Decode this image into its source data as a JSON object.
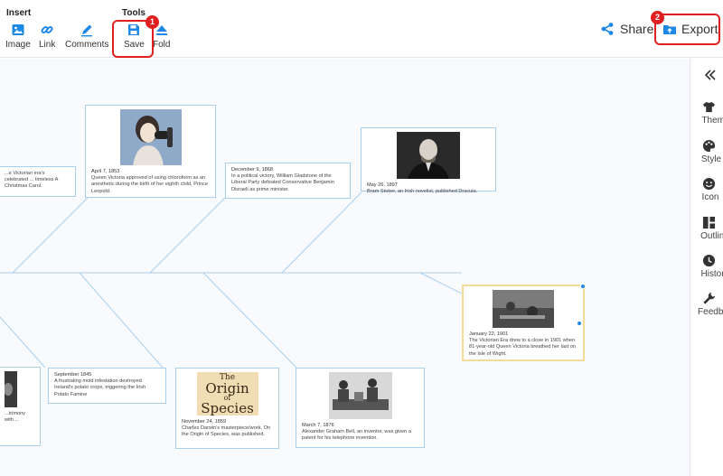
{
  "toolbar": {
    "insert_title": "Insert",
    "tools_title": "Tools",
    "items": {
      "image": {
        "label": "Image",
        "icon": "image-icon"
      },
      "link": {
        "label": "Link",
        "icon": "link-icon"
      },
      "comments": {
        "label": "Comments",
        "icon": "pen-icon"
      },
      "save": {
        "label": "Save",
        "icon": "save-icon"
      },
      "fold": {
        "label": "Fold",
        "icon": "fold-icon"
      }
    },
    "share_label": "Share",
    "export_label": "Export",
    "accent_color": "#1e88e5",
    "callout_color": "#e02020",
    "callouts": [
      "1",
      "2"
    ]
  },
  "timeline": {
    "events": [
      {
        "date": "",
        "desc": "...e Victorian era's celebrated ... timeless A Christmas Carol."
      },
      {
        "date": "April 7, 1853",
        "desc": "Queen Victoria approved of using chloroform as an anesthetic during the birth of her eighth child, Prince Leopold."
      },
      {
        "date": "December 9, 1868",
        "desc": "In a political victory, William Gladstone of the Liberal Party defeated Conservative Benjamin Disraeli as prime minister."
      },
      {
        "date": "May 26, 1897",
        "desc": "Bram Stoker, an Irish novelist, published Dracula."
      },
      {
        "date": "January 22, 1901",
        "desc": "The Victorian Era drew to a close in 1901 when 81-year-old Queen Victoria breathed her last on the Isle of Wight."
      },
      {
        "date": "",
        "desc": "...trimony with ..."
      },
      {
        "date": "September 1845",
        "desc": "A frustrating mold infestation destroyed Ireland's potato crops, triggering the Irish Potato Famine"
      },
      {
        "date": "November 24, 1859",
        "desc": "Charles Darwin's masterpiece/work, On the Origin of Species, was published."
      },
      {
        "date": "March 7, 1876",
        "desc": "Alexander Graham Bell, an inventor, was given a patent for his telephone invention."
      }
    ],
    "origin_book": {
      "line1": "The",
      "line2": "Origin",
      "line3": "of",
      "line4": "Species"
    }
  },
  "right_panel": {
    "collapse_icon": "double-chevron-left-icon",
    "items": [
      {
        "label": "Theme",
        "icon": "shirt-icon"
      },
      {
        "label": "Style",
        "icon": "palette-icon"
      },
      {
        "label": "Icon",
        "icon": "smiley-icon"
      },
      {
        "label": "Outline",
        "icon": "outline-icon"
      },
      {
        "label": "History",
        "icon": "clock-icon"
      },
      {
        "label": "Feedback",
        "icon": "wrench-icon"
      }
    ]
  }
}
